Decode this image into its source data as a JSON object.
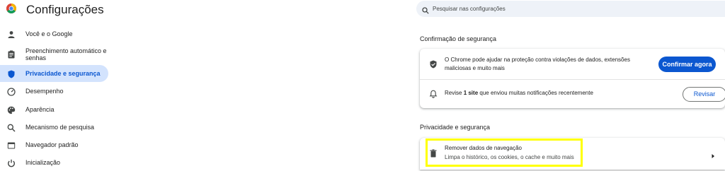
{
  "app": {
    "title": "Configurações"
  },
  "search": {
    "placeholder": "Pesquisar nas configurações"
  },
  "sidebar": {
    "items": [
      {
        "label": "Você e o Google",
        "icon": "person-icon",
        "active": false
      },
      {
        "label": "Preenchimento automático e senhas",
        "icon": "clipboard-icon",
        "active": false
      },
      {
        "label": "Privacidade e segurança",
        "icon": "shield-icon",
        "active": true
      },
      {
        "label": "Desempenho",
        "icon": "speedometer-icon",
        "active": false
      },
      {
        "label": "Aparência",
        "icon": "palette-icon",
        "active": false
      },
      {
        "label": "Mecanismo de pesquisa",
        "icon": "search-icon",
        "active": false
      },
      {
        "label": "Navegador padrão",
        "icon": "browser-window-icon",
        "active": false
      },
      {
        "label": "Inicialização",
        "icon": "power-icon",
        "active": false
      }
    ]
  },
  "safety_check": {
    "title": "Confirmação de segurança",
    "protection_text": "O Chrome pode ajudar na proteção contra violações de dados, extensões maliciosas e muito mais",
    "confirm_button": "Confirmar agora",
    "notif_prefix": "Revise ",
    "notif_bold": "1 site",
    "notif_suffix": " que enviou muitas notificações recentemente",
    "review_button": "Revisar"
  },
  "privacy": {
    "title": "Privacidade e segurança",
    "clear_data_title": "Remover dados de navegação",
    "clear_data_subtitle": "Limpa o histórico, os cookies, o cache e muito mais"
  },
  "colors": {
    "accent": "#0b57d0",
    "active_nav_bg": "#d3e3fd",
    "highlight": "#ffff00"
  }
}
